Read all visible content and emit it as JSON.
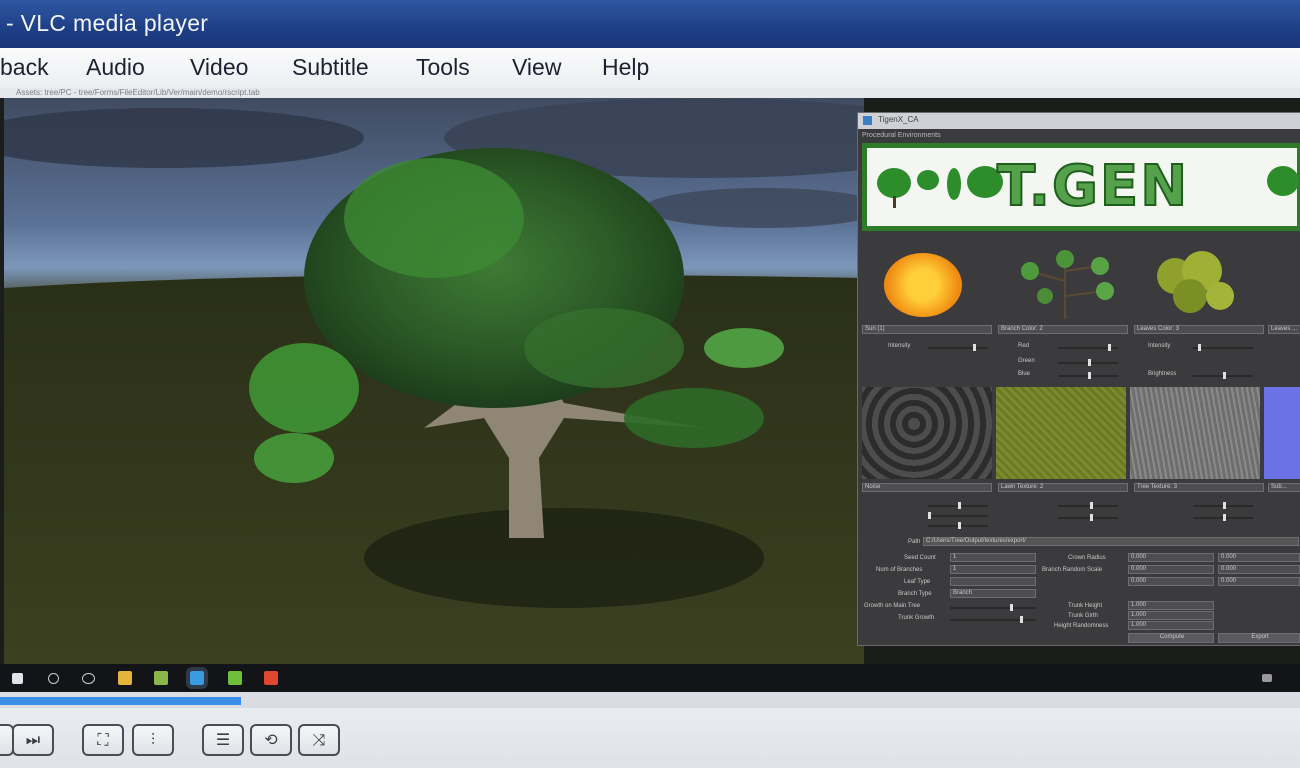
{
  "window": {
    "title": "- VLC media player"
  },
  "menu": {
    "items": [
      "back",
      "Audio",
      "Video",
      "Subtitle",
      "Tools",
      "View",
      "Help"
    ]
  },
  "video": {
    "inner_bar_text": "Assets: tree/PC - tree/Forms/FileEditor/Lib/Ver/main/demo/rscript.tab",
    "tgen": {
      "window_title": "TigenX_CA",
      "subtitle": "Procedural Environments",
      "logo_text": "T.GEN",
      "row1": [
        "Sun (1)",
        "Branch Color: 2",
        "Leaves Color: 3",
        "Leaves ..."
      ],
      "row1_labels": [
        "Intensity",
        "Red",
        "Green",
        "Blue",
        "Brightness"
      ],
      "row2": [
        "Noise",
        "Lawn Texture: 2",
        "Tree Texture: 3",
        "Sub..."
      ],
      "path_label": "Path",
      "path_value": "C:/Users/Tree/Output/textures/export/",
      "params": [
        "Seed Count",
        "Num of Branches",
        "Leaf Type",
        "Branch Type",
        "Growth on Main Tree",
        "Trunk Growth"
      ],
      "param_values": [
        "1",
        "1",
        "",
        "Branch"
      ],
      "right_params": [
        "Crown Radius",
        "Branch Random Scale",
        "Trunk Height",
        "Trunk Girth",
        "Height Randomness"
      ],
      "buttons": [
        "Compute",
        "Export"
      ],
      "values": [
        "0.000",
        "0.000",
        "0.000",
        "1.000",
        "1.000",
        "1.000"
      ]
    },
    "taskbar": {
      "clock": ""
    }
  },
  "controls": {
    "progress_percent": 18.5,
    "buttons": [
      "prev",
      "next",
      "fullscreen",
      "extended",
      "playlist",
      "loop",
      "random"
    ]
  },
  "colors": {
    "accent": "#3b8ee8",
    "titlebar": "#1e3f86",
    "tgen_green": "#2e7c2a"
  }
}
